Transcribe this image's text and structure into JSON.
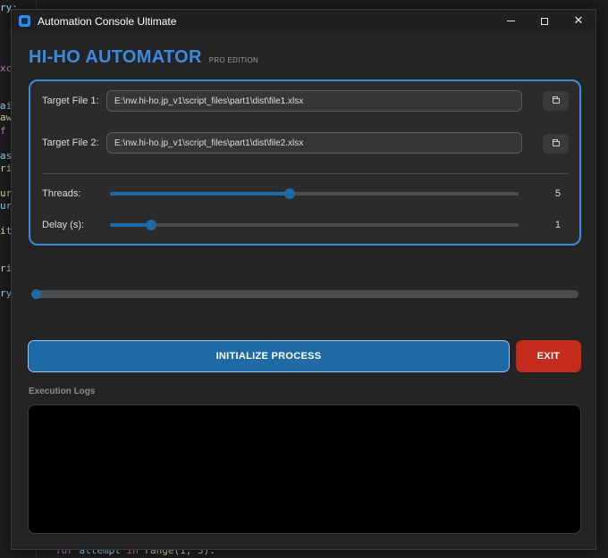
{
  "background_code": {
    "fragments": [
      "ry:",
      "xc",
      "ai",
      "aw",
      "f",
      "as",
      "ri",
      "ur",
      "ur",
      "it",
      "ri",
      "ry"
    ],
    "bottom_line": {
      "keyword_for": "for",
      "var": "attempt",
      "keyword_in": "in",
      "func": "range",
      "args": "(1, 3):"
    }
  },
  "window": {
    "title": "Automation Console Ultimate",
    "controls": {
      "minimize": "minimize",
      "maximize": "maximize",
      "close": "✕"
    }
  },
  "header": {
    "brand": "HI-HO AUTOMATOR",
    "edition": "PRO EDITION"
  },
  "config": {
    "file1": {
      "label": "Target File 1:",
      "value": "E:\\nw.hi-ho.jp_v1\\script_files\\part1\\dist\\file1.xlsx",
      "button_icon": "folder-icon"
    },
    "file2": {
      "label": "Target File 2:",
      "value": "E:\\nw.hi-ho.jp_v1\\script_files\\part1\\dist\\file2.xlsx",
      "button_icon": "folder-icon"
    },
    "threads": {
      "label": "Threads:",
      "value": "5",
      "fraction": 0.44
    },
    "delay": {
      "label": "Delay (s):",
      "value": "1",
      "fraction": 0.1
    }
  },
  "progress": {
    "fraction": 0.0
  },
  "actions": {
    "init_label": "INITIALIZE PROCESS",
    "exit_label": "EXIT"
  },
  "logs": {
    "label": "Execution Logs",
    "content": ""
  },
  "colors": {
    "accent": "#3a8be0",
    "primary": "#1f6aa5",
    "danger": "#c42b1c",
    "bg": "#242424"
  }
}
